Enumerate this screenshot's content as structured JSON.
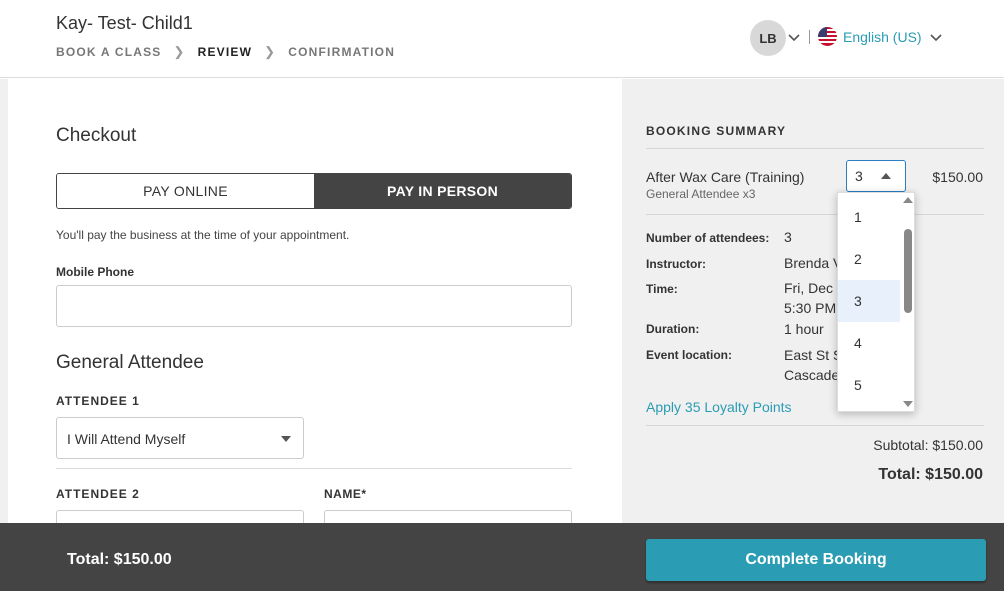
{
  "header": {
    "business_name": "Kay- Test- Child1",
    "breadcrumb": [
      "BOOK A CLASS",
      "REVIEW",
      "CONFIRMATION"
    ],
    "breadcrumb_active_index": 1,
    "user_initials": "LB",
    "language": "English (US)"
  },
  "checkout": {
    "title": "Checkout",
    "pay_online_label": "PAY ONLINE",
    "pay_in_person_label": "PAY IN PERSON",
    "selected_payment": "PAY IN PERSON",
    "pay_note": "You'll pay the business at the time of your appointment.",
    "mobile_phone_label": "Mobile Phone",
    "mobile_phone_value": ""
  },
  "attendees": {
    "section_title": "General Attendee",
    "attendee1_label": "ATTENDEE 1",
    "attendee1_value": "I Will Attend Myself",
    "attendee2_label": "ATTENDEE 2",
    "name_label": "NAME*"
  },
  "summary": {
    "title": "BOOKING SUMMARY",
    "item_name": "After Wax Care (Training)",
    "item_sub": "General Attendee x3",
    "quantity": "3",
    "item_price": "$150.00",
    "details": {
      "attendees_label": "Number of attendees:",
      "attendees_value": "3",
      "instructor_label": "Instructor:",
      "instructor_value": "Brenda V",
      "time_label": "Time:",
      "time_value_1": "Fri, Dec",
      "time_value_2": "5:30 PM",
      "duration_label": "Duration:",
      "duration_value": "1 hour",
      "location_label": "Event location:",
      "location_value_1": "East St S",
      "location_value_2": "Cascade"
    },
    "loyalty_link": "Apply 35 Loyalty Points",
    "subtotal": "Subtotal: $150.00",
    "total": "Total: $150.00"
  },
  "quantity_dropdown": {
    "options": [
      "1",
      "2",
      "3",
      "4",
      "5"
    ],
    "selected": "3"
  },
  "footer": {
    "total": "Total: $150.00",
    "complete_button": "Complete Booking"
  },
  "colors": {
    "accent": "#2a9cb4",
    "dark": "#444444",
    "panel": "#f0f0f0"
  }
}
